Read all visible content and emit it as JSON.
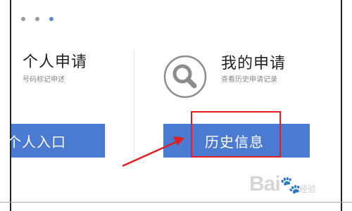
{
  "carousel": {
    "dot_count": 3,
    "active_index": 2
  },
  "left_panel": {
    "title": "个人申请",
    "subtitle": "号码标记申述",
    "button_label": "个人入口"
  },
  "right_panel": {
    "title": "我的申请",
    "subtitle": "查看历史申请记录",
    "button_label": "历史信息",
    "icon": "search-icon"
  },
  "annotation": {
    "color": "#e01e1e"
  },
  "watermark": {
    "text": "Bai",
    "suffix": "经验"
  },
  "colors": {
    "button_blue": "#4a7bd1",
    "icon_gray": "#8c8c8c"
  }
}
